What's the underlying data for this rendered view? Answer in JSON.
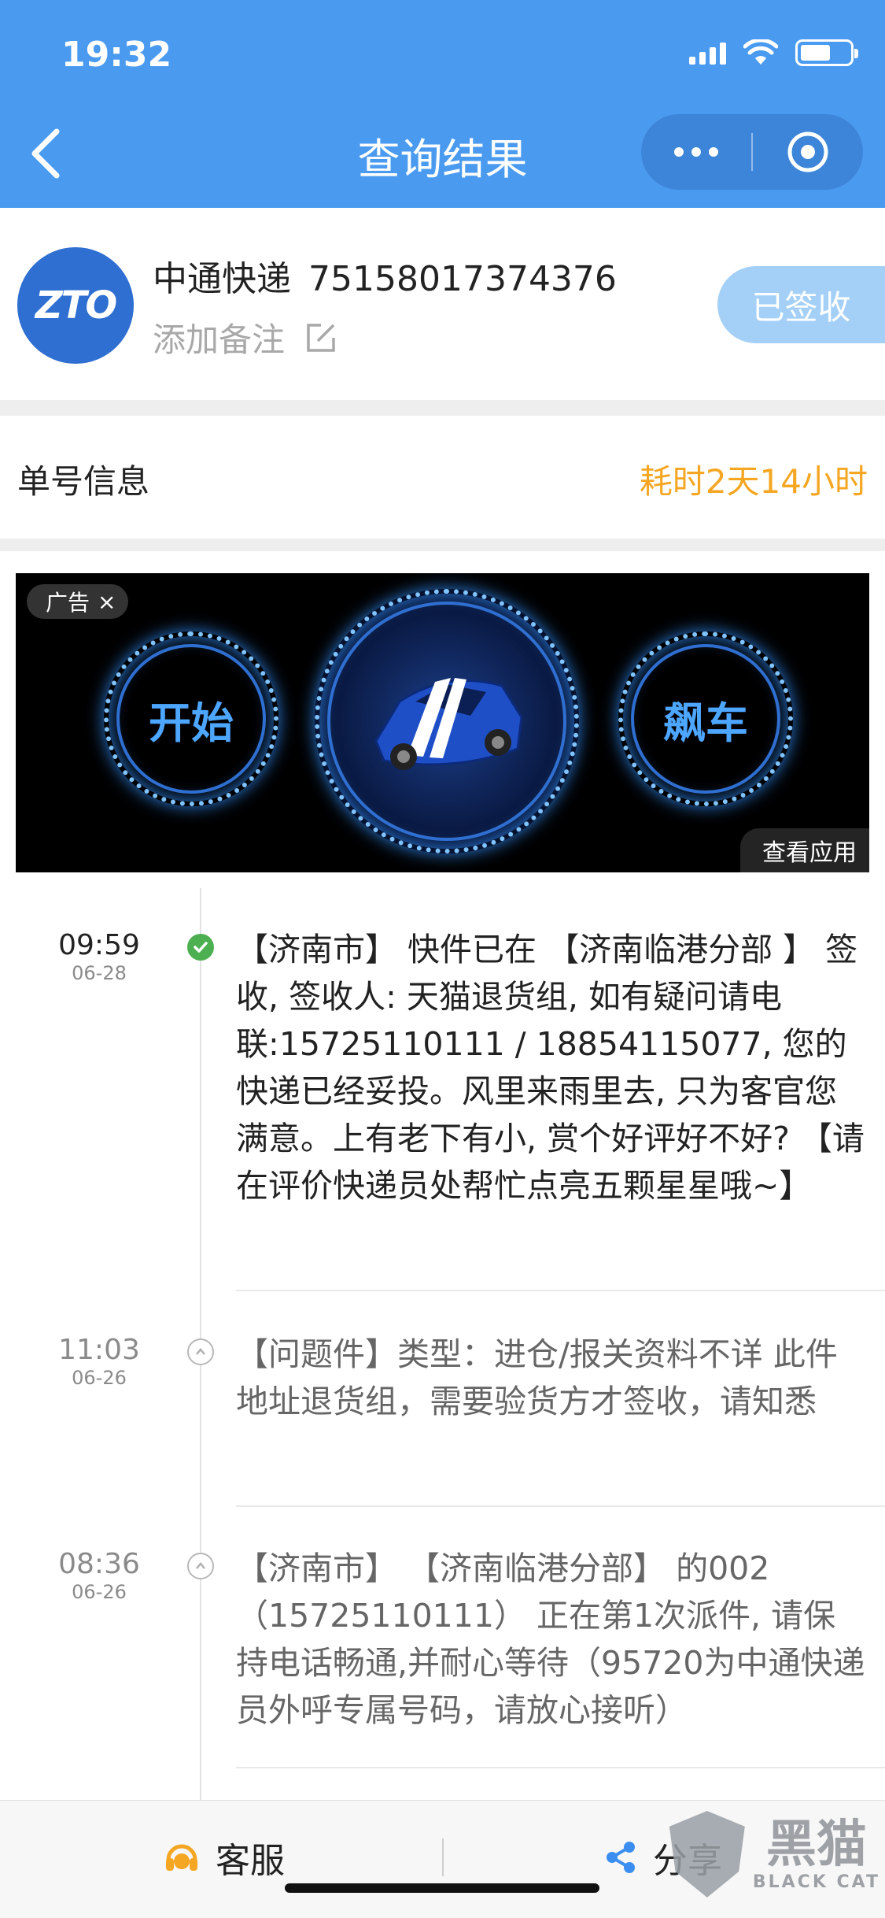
{
  "status_bar": {
    "time": "19:32"
  },
  "header": {
    "title": "查询结果"
  },
  "package": {
    "logo_text": "ZTO",
    "courier": "中通快递",
    "tracking_number": "75158017374376",
    "note_placeholder": "添加备注",
    "status_badge": "已签收"
  },
  "info": {
    "label": "单号信息",
    "duration": "耗时2天14小时"
  },
  "ad": {
    "tag": "广告",
    "close": "×",
    "left_text": "开始",
    "right_text": "飙车",
    "view_app": "查看应用"
  },
  "timeline": [
    {
      "time": "09:59",
      "date": "06-28",
      "status": "done",
      "text": "【济南市】 快件已在 【济南临港分部 】 签收, 签收人: 天猫退货组, 如有疑问请电联:15725110111 / 18854115077, 您的快递已经妥投。风里来雨里去, 只为客官您满意。上有老下有小, 赏个好评好不好? 【请在评价快递员处帮忙点亮五颗星星哦~】"
    },
    {
      "time": "11:03",
      "date": "06-26",
      "status": "pending",
      "text": "【问题件】类型：进仓/报关资料不详 此件地址退货组，需要验货方才签收，请知悉"
    },
    {
      "time": "08:36",
      "date": "06-26",
      "status": "pending",
      "text": "【济南市】 【济南临港分部】 的002（15725110111） 正在第1次派件, 请保持电话畅通,并耐心等待（95720为中通快递员外呼专属号码，请放心接听）"
    }
  ],
  "bottom_bar": {
    "service": "客服",
    "share": "分享"
  },
  "watermark": {
    "cn": "黑猫",
    "en": "BLACK CAT"
  },
  "colors": {
    "header": "#4a9bf0",
    "accent_orange": "#f5a623",
    "done_green": "#4caf50",
    "badge": "#a4d0f7"
  }
}
